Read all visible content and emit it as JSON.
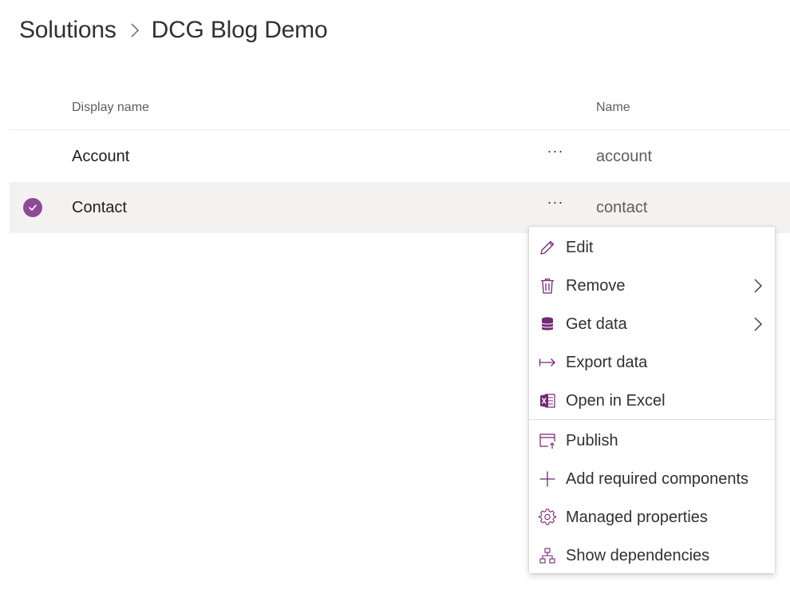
{
  "breadcrumb": {
    "root": "Solutions",
    "current": "DCG Blog Demo"
  },
  "table": {
    "columns": {
      "display_name": "Display name",
      "name": "Name"
    },
    "more_label": "···",
    "rows": [
      {
        "display_name": "Account",
        "name": "account",
        "selected": false
      },
      {
        "display_name": "Contact",
        "name": "contact",
        "selected": true
      }
    ]
  },
  "context_menu": {
    "items": [
      {
        "label": "Edit",
        "icon": "pencil-icon"
      },
      {
        "label": "Remove",
        "icon": "trash-icon",
        "submenu": true
      },
      {
        "label": "Get data",
        "icon": "database-icon",
        "submenu": true
      },
      {
        "label": "Export data",
        "icon": "export-arrow-icon"
      },
      {
        "label": "Open in Excel",
        "icon": "excel-icon"
      },
      {
        "label": "Publish",
        "icon": "publish-icon"
      },
      {
        "label": "Add required components",
        "icon": "plus-icon"
      },
      {
        "label": "Managed properties",
        "icon": "gear-icon"
      },
      {
        "label": "Show dependencies",
        "icon": "hierarchy-icon"
      }
    ]
  },
  "colors": {
    "accent": "#8e4a97",
    "icon_purple": "#742774",
    "selected_row": "#f3f2f1"
  }
}
